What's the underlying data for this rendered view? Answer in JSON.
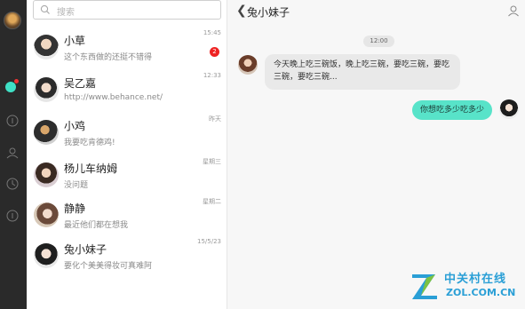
{
  "search": {
    "placeholder": "搜索"
  },
  "conversations": [
    {
      "name": "小草",
      "preview": "这个东西做的还挺不错得",
      "time": "15:45",
      "unread": "2"
    },
    {
      "name": "吴乙嘉",
      "preview": "http://www.behance.net/",
      "time": "12:33"
    },
    {
      "name": "小鸡",
      "preview": "我要吃肯德鸡!",
      "time": "昨天"
    },
    {
      "name": "杨儿车纳姆",
      "preview": "没问题",
      "time": "星期三"
    },
    {
      "name": "静静",
      "preview": "最近他们都在想我",
      "time": "星期二"
    },
    {
      "name": "兔小妹子",
      "preview": "要化个美美得妆可真难阿",
      "time": "15/5/23"
    }
  ],
  "chat": {
    "title": "兔小妹子",
    "timestamp": "12:00",
    "incoming": "今天晚上吃三碗饭，晚上吃三碗，要吃三碗，要吃三碗，要吃三碗...",
    "outgoing": "你想吃多少吃多少"
  },
  "watermark": {
    "name": "中关村在线",
    "url": "ZOL.COM.CN"
  },
  "colors": {
    "accent": "#3fe0c5",
    "unread": "#e22222",
    "rail": "#2a2a2a"
  }
}
